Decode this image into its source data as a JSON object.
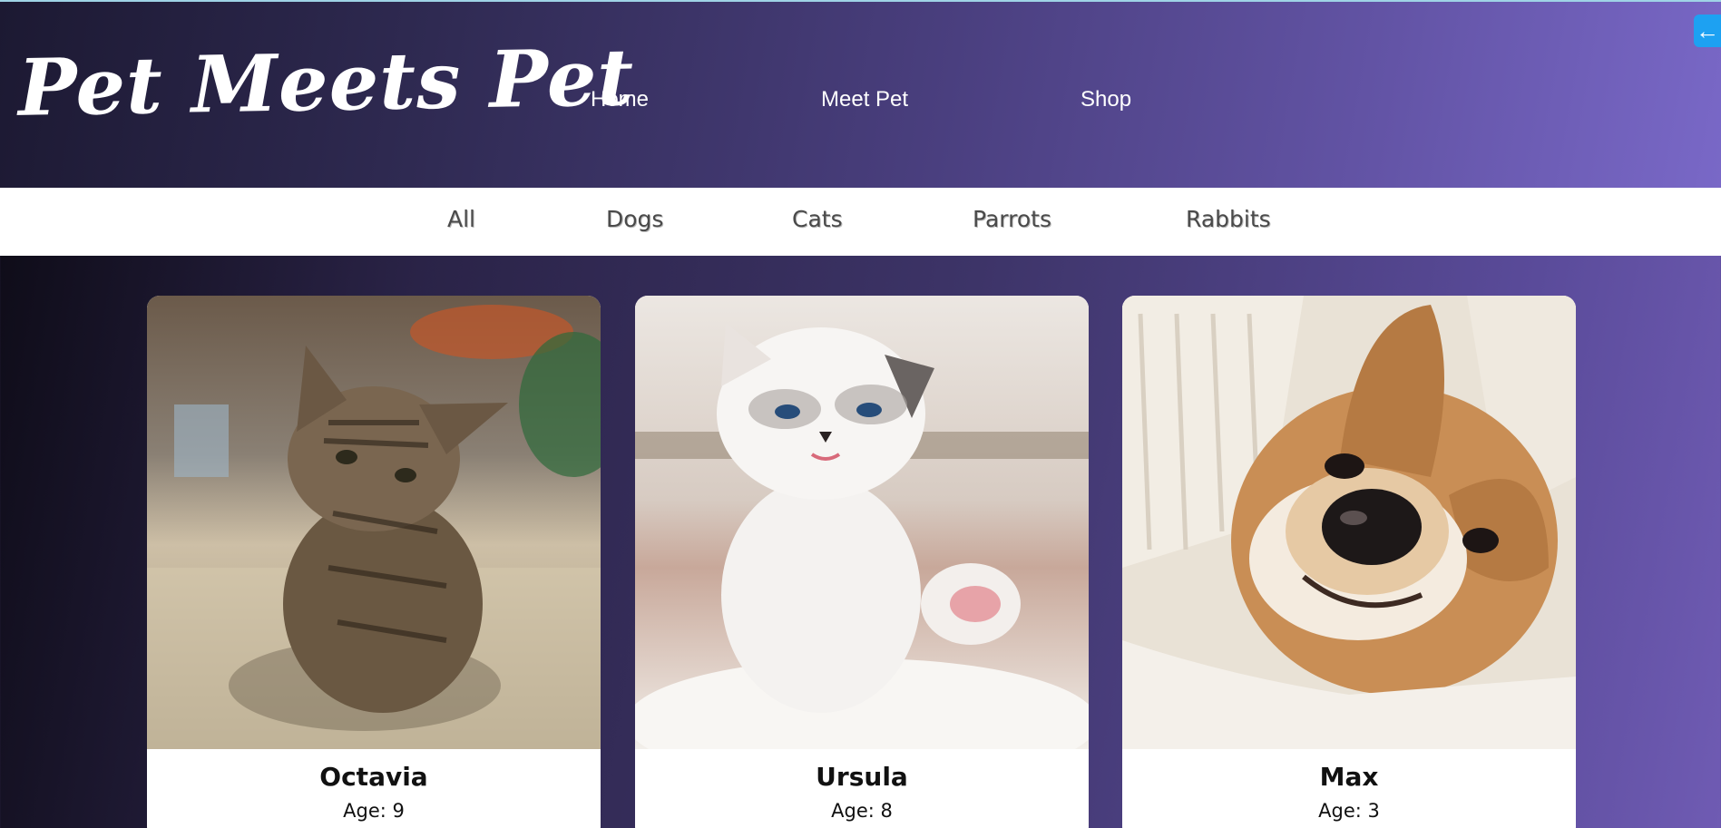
{
  "header": {
    "logo": "Pet Meets Pet",
    "menu": [
      "Home",
      "Meet Pet",
      "Shop"
    ]
  },
  "filters": [
    "All",
    "Dogs",
    "Cats",
    "Parrots",
    "Rabbits"
  ],
  "pets": [
    {
      "name": "Octavia",
      "age": "Age: 9",
      "photo": "tabby-kitten-photo"
    },
    {
      "name": "Ursula",
      "age": "Age: 8",
      "photo": "white-kitten-photo"
    },
    {
      "name": "Max",
      "age": "Age: 3",
      "photo": "corgi-dog-photo"
    }
  ],
  "icons": {
    "back": "arrow-left-icon"
  },
  "colors": {
    "accent": "#1da1f2",
    "header_start": "#1c1932",
    "header_end": "#7968c7"
  }
}
